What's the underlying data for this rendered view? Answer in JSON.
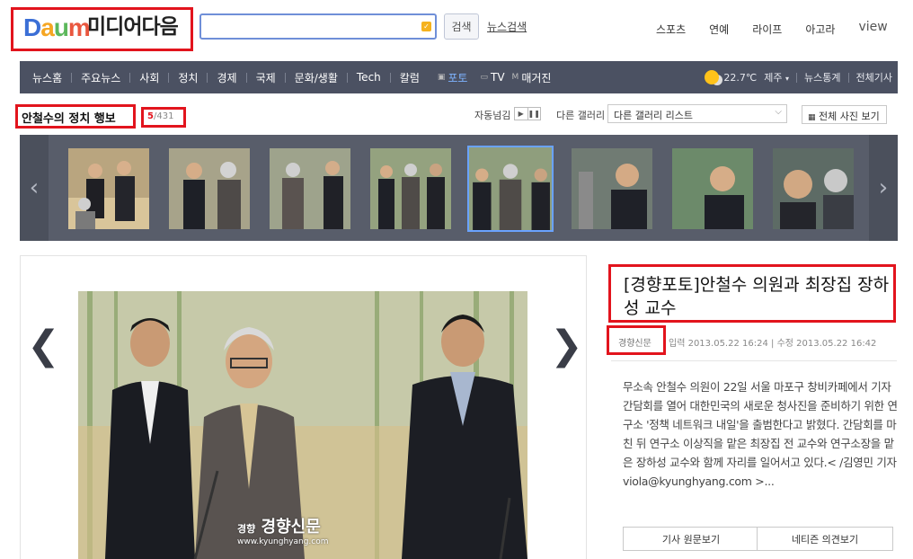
{
  "header": {
    "logo": {
      "d": "D",
      "a": "a",
      "u": "u",
      "m": "m"
    },
    "brand": "미디어다음",
    "search": {
      "value": "",
      "placeholder": ""
    },
    "search_button": "검색",
    "news_search": "뉴스검색",
    "topnav": [
      "스포츠",
      "연예",
      "라이프",
      "아고라",
      "view"
    ]
  },
  "gnb": {
    "items": [
      "뉴스홈",
      "주요뉴스",
      "사회",
      "정치",
      "경제",
      "국제",
      "문화/생활",
      "Tech",
      "칼럼"
    ],
    "media": [
      {
        "icon": "▣",
        "label": "포토"
      },
      {
        "icon": "▭",
        "label": "TV"
      },
      {
        "icon": "M",
        "label": "매거진"
      }
    ],
    "weather": {
      "temp": "22.7℃",
      "city": "제주"
    },
    "links": [
      "뉴스통계",
      "전체기사"
    ]
  },
  "gallery": {
    "title": "안철수의 정치 행보",
    "current": "5",
    "total": "/431",
    "autoplay_label": "자동넘김",
    "autoplay_icons": [
      "▶",
      "❚❚"
    ],
    "other_label": "다른 갤러리",
    "select_value": "다른 갤러리 리스트",
    "all_photos": "전체 사진 보기",
    "selected_index": 4,
    "thumb_count": 8
  },
  "photo": {
    "watermark": "경향신문",
    "watermark_brand": "경향",
    "watermark_url": "www.kyunghyang.com"
  },
  "article": {
    "headline": "[경향포토]안철수 의원과 최장집 장하성 교수",
    "source": "경향신문",
    "input_time": "입력 2013.05.22 16:24",
    "edit_time": "수정 2013.05.22 16:42",
    "body": "무소속 안철수 의원이 22일 서울 마포구 창비카페에서 기자간담회를 열어 대한민국의 새로운 청사진을 준비하기 위한 연구소 '정책 네트워크 내일'을 출범한다고 밝혔다. 간담회를 마친 뒤 연구소 이상직을 맡은 최장집 전 교수와 연구소장을 맡은 장하성 교수와 함께 자리를 일어서고 있다.< /김영민 기자 viola@kyunghyang.com >...",
    "btn_original": "기사 원문보기",
    "btn_comments": "네티즌 의견보기"
  },
  "colors": {
    "accent": "#e2141d",
    "gnb": "#4b5162",
    "strip": "#585d6a",
    "selected": "#6aa3ff"
  }
}
